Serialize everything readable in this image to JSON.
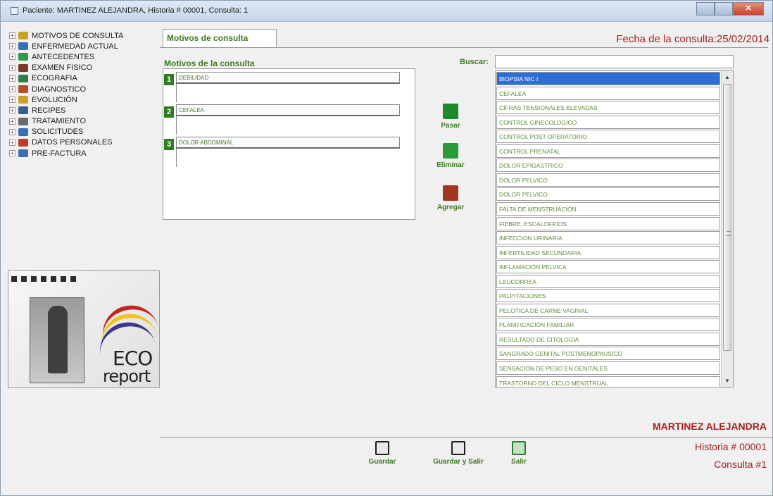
{
  "window": {
    "title": "Paciente: MARTINEZ ALEJANDRA, Historia # 00001, Consulta: 1",
    "close_glyph": "✕"
  },
  "tree": {
    "items": [
      {
        "label": "MOTIVOS DE CONSULTA",
        "icon": "money-icon",
        "color": "#c9a227"
      },
      {
        "label": "ENFERMEDAD ACTUAL",
        "icon": "chart-icon",
        "color": "#3a6fb5"
      },
      {
        "label": "ANTECEDENTES",
        "icon": "globe-icon",
        "color": "#2e9a4a"
      },
      {
        "label": "EXAMEN FISICO",
        "icon": "scale-icon",
        "color": "#7a3a2a"
      },
      {
        "label": "ECOGRAFIA",
        "icon": "monitor-icon",
        "color": "#2f7d4e"
      },
      {
        "label": "DIAGNOSTICO",
        "icon": "bird-icon",
        "color": "#b84b2a"
      },
      {
        "label": "EVOLUCIÓN",
        "icon": "money-icon",
        "color": "#c9a227"
      },
      {
        "label": "RECIPES",
        "icon": "people-icon",
        "color": "#3a5d8c"
      },
      {
        "label": "TRATAMIENTO",
        "icon": "grid-icon",
        "color": "#6a6a6a"
      },
      {
        "label": "SOLICITUDES",
        "icon": "globe-icon",
        "color": "#3a6fb5"
      },
      {
        "label": "DATOS PERSONALES",
        "icon": "apple-icon",
        "color": "#c0392b"
      },
      {
        "label": "PRE-FACTURA",
        "icon": "invoice-icon",
        "color": "#3a6fb5"
      }
    ]
  },
  "logo": {
    "line1": "ECO",
    "line2": "report"
  },
  "tab": {
    "label": "Motivos de consulta"
  },
  "fecha": "Fecha de la consulta:25/02/2014",
  "motivos": {
    "label": "Motivos de la consulta",
    "items": [
      {
        "num": "1",
        "text": "DEBILIDAD"
      },
      {
        "num": "2",
        "text": "CEFALEA"
      },
      {
        "num": "3",
        "text": "DOLOR ABDOMINAL"
      }
    ]
  },
  "actions": {
    "pasar": "Pasar",
    "eliminar": "Eliminar",
    "agregar": "Agregar"
  },
  "search": {
    "label": "Buscar:",
    "value": ""
  },
  "list": {
    "selected_index": 0,
    "items": [
      "BIOPSIA NIC I",
      "CEFALEA",
      "CIFRAS TENSIONALES ELEVADAS",
      "CONTROL GINECOLOGICO",
      "CONTROL POST OPERATORIO",
      "CONTROL PRENATAL",
      "DOLOR EPIGASTRICO",
      "DOLOR PELVICO",
      "DOLOR PELVICO",
      "FALTA DE MENSTRUACIÓN",
      "FIEBRE, ESCALOFRIOS",
      "INFECCION URINARIA",
      "INFERTILIDAD SECUNDARIA",
      "INFLAMACIÓN PELVICA",
      "LEUCORREA",
      "PALPITACIONES",
      "PELOTICA DE CARNE VAGINAL",
      "PLANIFICACIÓN  FAMILIAR",
      "RESULTADO DE CITOLOGIA",
      "SANGRADO GENITAL POSTMENOPAUSICO",
      "SENSACIÓN DE PESO EN GENITALES",
      "TRASTORNO DEL CICLO MENSTRUAL"
    ]
  },
  "patient": {
    "name": "MARTINEZ ALEJANDRA",
    "historia": "Historia # 00001",
    "consulta": "Consulta #1"
  },
  "bottom_buttons": {
    "guardar": "Guardar",
    "guardar_salir": "Guardar y Salir",
    "salir": "Salir"
  }
}
